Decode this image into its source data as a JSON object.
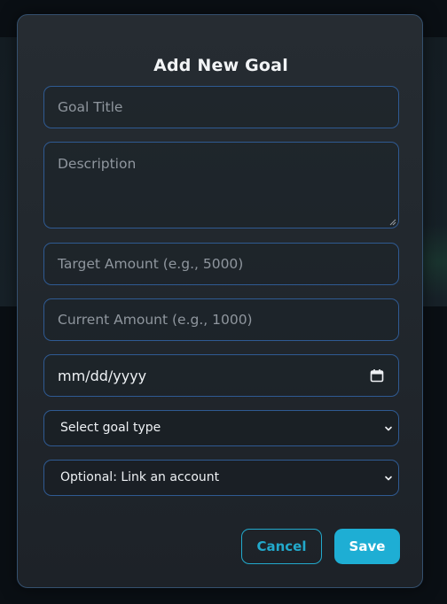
{
  "dialog": {
    "title": "Add New Goal"
  },
  "form": {
    "goal_title_placeholder": "Goal Title",
    "description_placeholder": "Description",
    "target_amount_placeholder": "Target Amount (e.g., 5000)",
    "current_amount_placeholder": "Current Amount (e.g., 1000)",
    "date_value": "mm/dd/yyyy",
    "goal_type_selected": "Select goal type",
    "account_selected": "Optional: Link an account"
  },
  "actions": {
    "cancel_label": "Cancel",
    "save_label": "Save"
  },
  "icons": {
    "date": "calendar-icon",
    "select": "chevron-down-icon"
  },
  "colors": {
    "accent": "#1eaed4",
    "field_border": "#2f5a92",
    "modal_bg": "#23292f"
  }
}
